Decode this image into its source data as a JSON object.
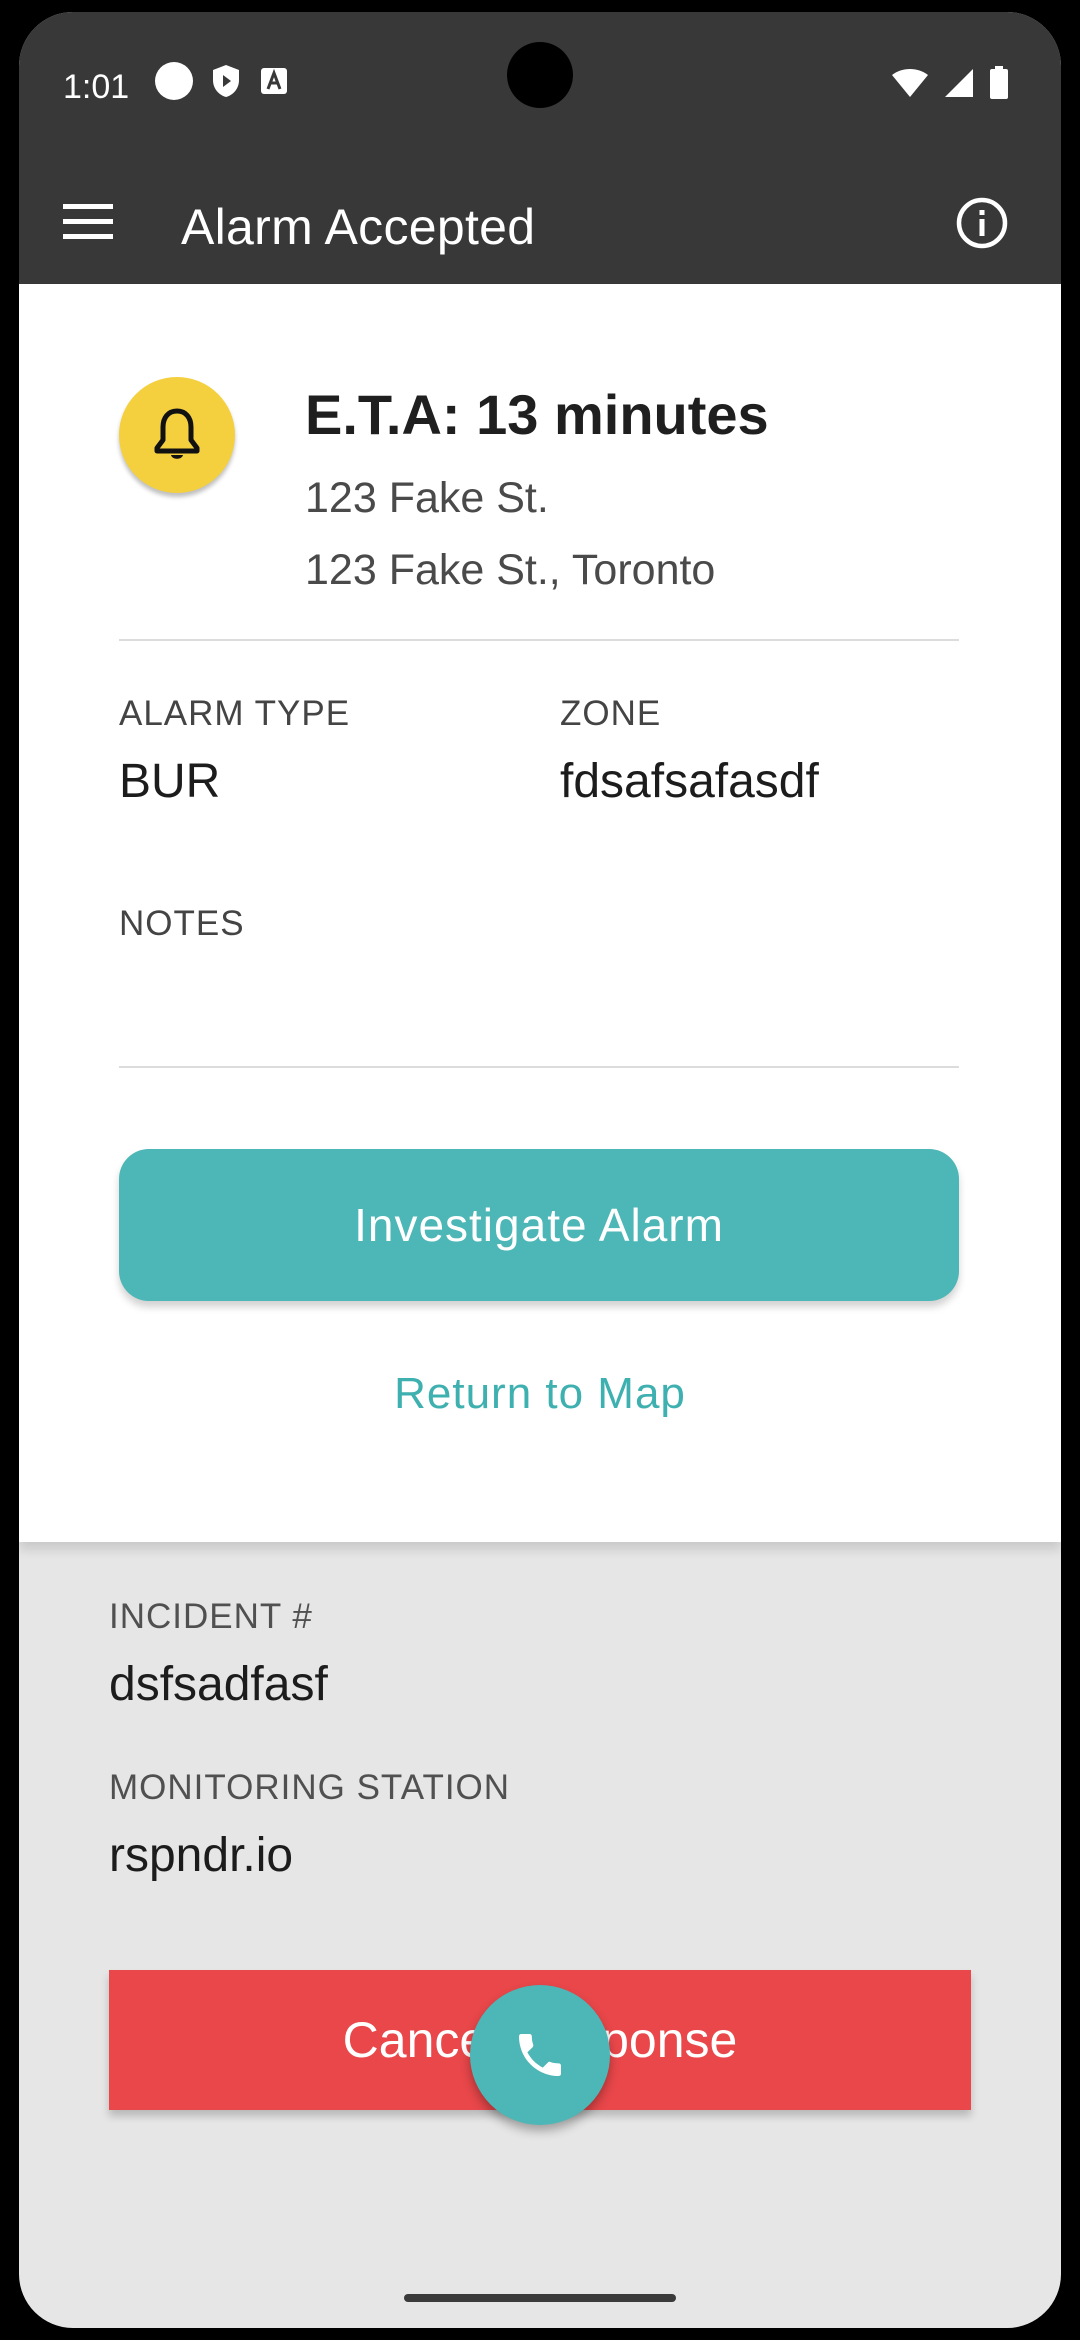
{
  "status_bar": {
    "time": "1:01"
  },
  "app_bar": {
    "title": "Alarm Accepted",
    "menu_icon": "hamburger-menu-icon",
    "info_icon": "info-icon"
  },
  "alarm": {
    "icon": "bell-icon",
    "eta": "E.T.A: 13 minutes",
    "address_line1": "123 Fake St.",
    "address_line2": "123 Fake St., Toronto"
  },
  "details": {
    "alarm_type_label": "ALARM TYPE",
    "alarm_type_value": "BUR",
    "zone_label": "ZONE",
    "zone_value": "fdsafsafasdf",
    "notes_label": "NOTES",
    "notes_value": ""
  },
  "actions": {
    "investigate_label": "Investigate Alarm",
    "return_label": "Return to Map",
    "cancel_label": "Cancel Response"
  },
  "incident": {
    "incident_label": "INCIDENT #",
    "incident_value": "dsfsadfasf",
    "station_label": "MONITORING STATION",
    "station_value": "rspndr.io"
  },
  "colors": {
    "accent": "#4db6b6",
    "cancel": "#e9474a",
    "bell_badge": "#f4d03f",
    "app_bar": "#383838"
  }
}
